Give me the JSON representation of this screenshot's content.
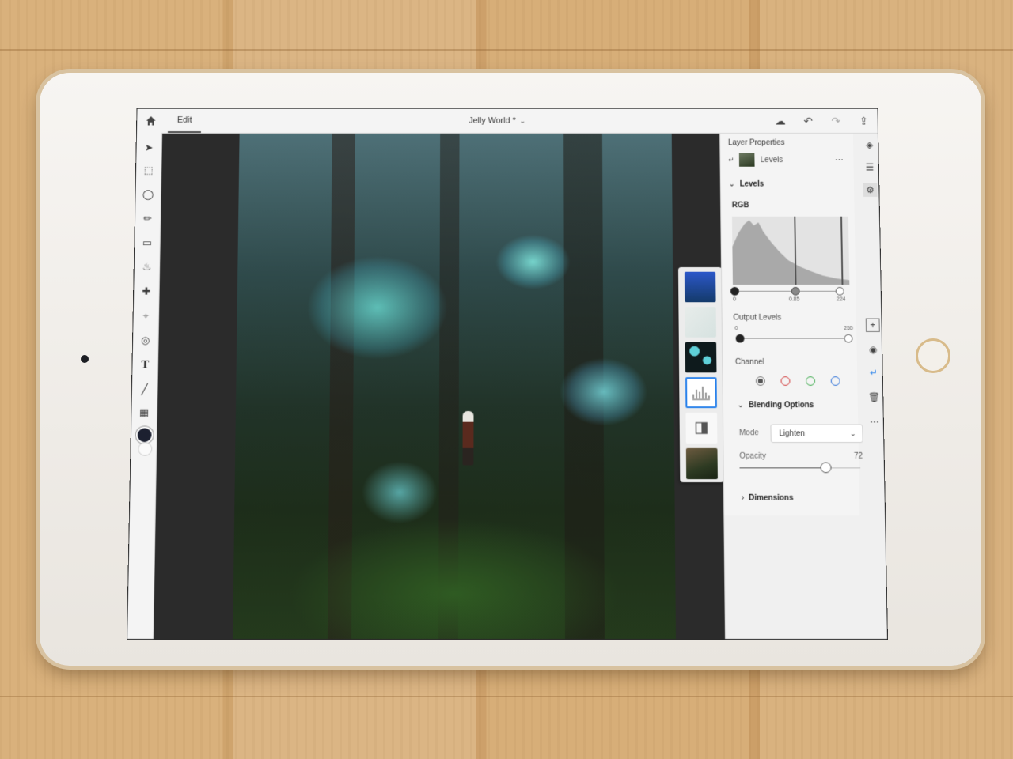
{
  "topbar": {
    "edit_tab": "Edit",
    "doc_title": "Jelly World *",
    "icons": [
      "home-icon",
      "cloud-icon",
      "undo-icon",
      "redo-icon",
      "share-icon"
    ]
  },
  "toolbar": {
    "tools": [
      "move-tool-icon",
      "marquee-tool-icon",
      "lasso-tool-icon",
      "brush-tool-icon",
      "eraser-tool-icon",
      "fill-tool-icon",
      "healing-tool-icon",
      "crop-tool-icon",
      "clone-tool-icon",
      "type-tool-icon",
      "line-tool-icon",
      "image-tool-icon"
    ],
    "type_glyph": "T",
    "foreground_color": "#1c2030",
    "background_color": "#fafafa"
  },
  "panel": {
    "title": "Layer Properties",
    "layer_name": "Levels",
    "levels": {
      "heading": "Levels",
      "channel_label": "RGB",
      "input_ticks": [
        "0",
        "0.85",
        "224"
      ],
      "output_heading": "Output Levels",
      "output_ticks": [
        "0",
        "255"
      ]
    },
    "channel": {
      "heading": "Channel",
      "swatch_colors": [
        "#777777",
        "#d23c3c",
        "#3aaa4a",
        "#2a6fd8"
      ]
    },
    "blending": {
      "heading": "Blending Options",
      "mode_label": "Mode",
      "mode_value": "Lighten",
      "opacity_label": "Opacity",
      "opacity_value": "72"
    },
    "dimensions_heading": "Dimensions"
  },
  "accent_color": "#2680eb"
}
